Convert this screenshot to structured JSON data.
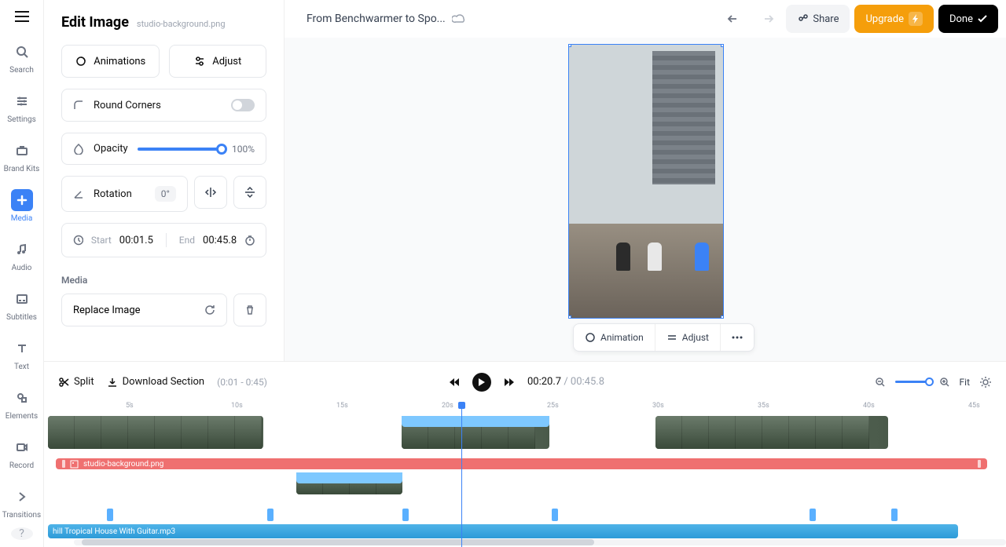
{
  "rail": {
    "items": [
      {
        "label": "Search",
        "name": "search"
      },
      {
        "label": "Settings",
        "name": "settings"
      },
      {
        "label": "Brand Kits",
        "name": "brand-kits"
      },
      {
        "label": "Media",
        "name": "media",
        "active": true
      },
      {
        "label": "Audio",
        "name": "audio"
      },
      {
        "label": "Subtitles",
        "name": "subtitles"
      },
      {
        "label": "Text",
        "name": "text"
      },
      {
        "label": "Elements",
        "name": "elements"
      },
      {
        "label": "Record",
        "name": "record"
      },
      {
        "label": "Transitions",
        "name": "transitions"
      }
    ]
  },
  "panel": {
    "title": "Edit Image",
    "filename": "studio-background.png",
    "tabs": {
      "animations": "Animations",
      "adjust": "Adjust"
    },
    "round_corners": "Round Corners",
    "opacity_label": "Opacity",
    "opacity_value": "100%",
    "rotation_label": "Rotation",
    "rotation_value": "0°",
    "start_label": "Start",
    "start_value": "00:01.5",
    "end_label": "End",
    "end_value": "00:45.8",
    "media_section": "Media",
    "replace": "Replace Image"
  },
  "topbar": {
    "project": "From Benchwarmer to Spo...",
    "share": "Share",
    "upgrade": "Upgrade",
    "done": "Done"
  },
  "ctx": {
    "animation": "Animation",
    "adjust": "Adjust"
  },
  "tlbar": {
    "split": "Split",
    "download": "Download Section",
    "range": "(0:01 - 0:45)",
    "current": "00:20.7",
    "duration": "00:45.8",
    "fit": "Fit"
  },
  "ruler": [
    "5s",
    "10s",
    "15s",
    "20s",
    "25s",
    "30s",
    "35s",
    "40s",
    "45s"
  ],
  "img_clip": "studio-background.png",
  "audio_clip": "hill Tropical House With Guitar.mp3"
}
